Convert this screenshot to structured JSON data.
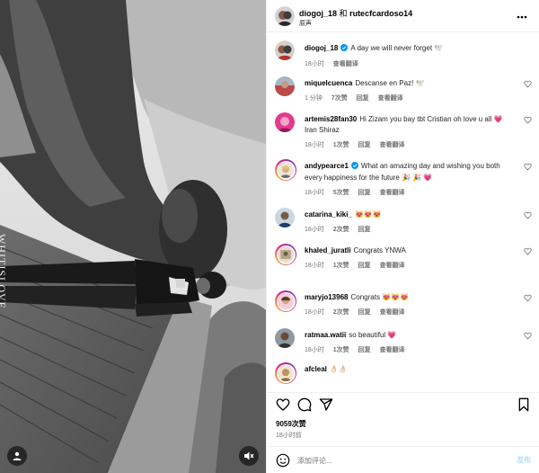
{
  "header": {
    "author1": "diogoj_18",
    "joiner": "和",
    "author2": "rutecfcardoso14",
    "audio": "原声",
    "more_icon": "more-horizontal-icon"
  },
  "photo": {
    "watermark": "WHITISLOVE.",
    "sound_icon": "sound-off-icon",
    "tag_icon": "tagged-people-icon"
  },
  "caption": {
    "user": "diogoj_18",
    "text": "A day we will never forget 🕊️",
    "time": "18小时",
    "translate": "查看翻译"
  },
  "comments": [
    {
      "user": "miquelcuenca",
      "text": "Descanse en Paz! 🕊️",
      "time": "1 分钟",
      "likes": "7次赞",
      "reply": "回复",
      "translate": "查看翻译"
    },
    {
      "user": "artemis28fan30",
      "text": "Hi Zizam you bay tbt Cristian oh love u all 💗 Iran Shiraz",
      "time": "18小时",
      "likes": "1次赞",
      "reply": "回复",
      "translate": "查看翻译"
    },
    {
      "user": "andypearce1",
      "text": "What an amazing day and wishing you both every happiness for the future 🎉 🎉 💗",
      "time": "18小时",
      "likes": "5次赞",
      "reply": "回复",
      "translate": "查看翻译",
      "verified": true
    },
    {
      "user": "catarina_kiki_",
      "text": "😻😻😻",
      "time": "18小时",
      "likes": "2次赞",
      "reply": "回复",
      "translate": ""
    },
    {
      "user": "khaled_juratli",
      "text": "Congrats YNWA",
      "time": "18小时",
      "likes": "1次赞",
      "reply": "回复",
      "translate": "查看翻译"
    },
    {
      "user": "maryjo13968",
      "text": "Congrats 😻😻😻",
      "time": "18小时",
      "likes": "2次赞",
      "reply": "回复",
      "translate": "查看翻译"
    },
    {
      "user": "ratmaa.watii",
      "text": "so beautiful 💗",
      "time": "18小时",
      "likes": "1次赞",
      "reply": "回复",
      "translate": "查看翻译"
    },
    {
      "user": "afcleal",
      "text": "👌🏻👌🏻",
      "time": "",
      "likes": "",
      "reply": "",
      "translate": ""
    }
  ],
  "actions": {
    "like_icon": "heart-icon",
    "comment_icon": "comment-icon",
    "share_icon": "share-icon",
    "save_icon": "bookmark-icon"
  },
  "stats": {
    "likes": "9059次赞",
    "posted": "18小时前"
  },
  "composer": {
    "placeholder": "添加评论...",
    "post_label": "发布",
    "emoji_icon": "emoji-icon"
  },
  "colors": {
    "verified": "#0095f6",
    "post_disabled": "#b2dffc",
    "meta": "#737373",
    "divider": "#efefef"
  }
}
